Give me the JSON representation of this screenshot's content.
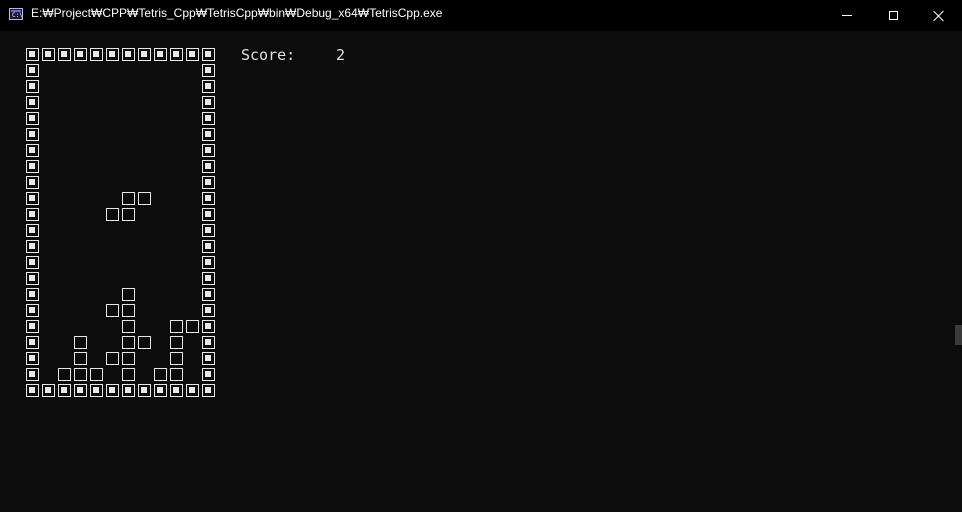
{
  "window": {
    "title": "E:₩Project₩CPP₩Tetris_Cpp₩TetrisCpp₩bin₩Debug_x64₩TetrisCpp.exe",
    "icon": "console-app-icon",
    "icon_text": "C:\\",
    "controls": [
      "minimize",
      "maximize",
      "close"
    ]
  },
  "game": {
    "score_label": "Score:",
    "score_value": "2",
    "board_cols": 12,
    "board_rows": 22,
    "blocks": [
      [
        6,
        9
      ],
      [
        7,
        9
      ],
      [
        5,
        10
      ],
      [
        6,
        10
      ],
      [
        6,
        15
      ],
      [
        5,
        16
      ],
      [
        6,
        16
      ],
      [
        6,
        17
      ],
      [
        9,
        17
      ],
      [
        10,
        17
      ],
      [
        3,
        18
      ],
      [
        6,
        18
      ],
      [
        7,
        18
      ],
      [
        9,
        18
      ],
      [
        3,
        19
      ],
      [
        5,
        19
      ],
      [
        6,
        19
      ],
      [
        9,
        19
      ],
      [
        2,
        20
      ],
      [
        3,
        20
      ],
      [
        4,
        20
      ],
      [
        6,
        20
      ],
      [
        8,
        20
      ],
      [
        9,
        20
      ]
    ]
  },
  "colors": {
    "background": "#0c0c0c",
    "titlebar": "#000000",
    "foreground": "#e8e8e8"
  }
}
